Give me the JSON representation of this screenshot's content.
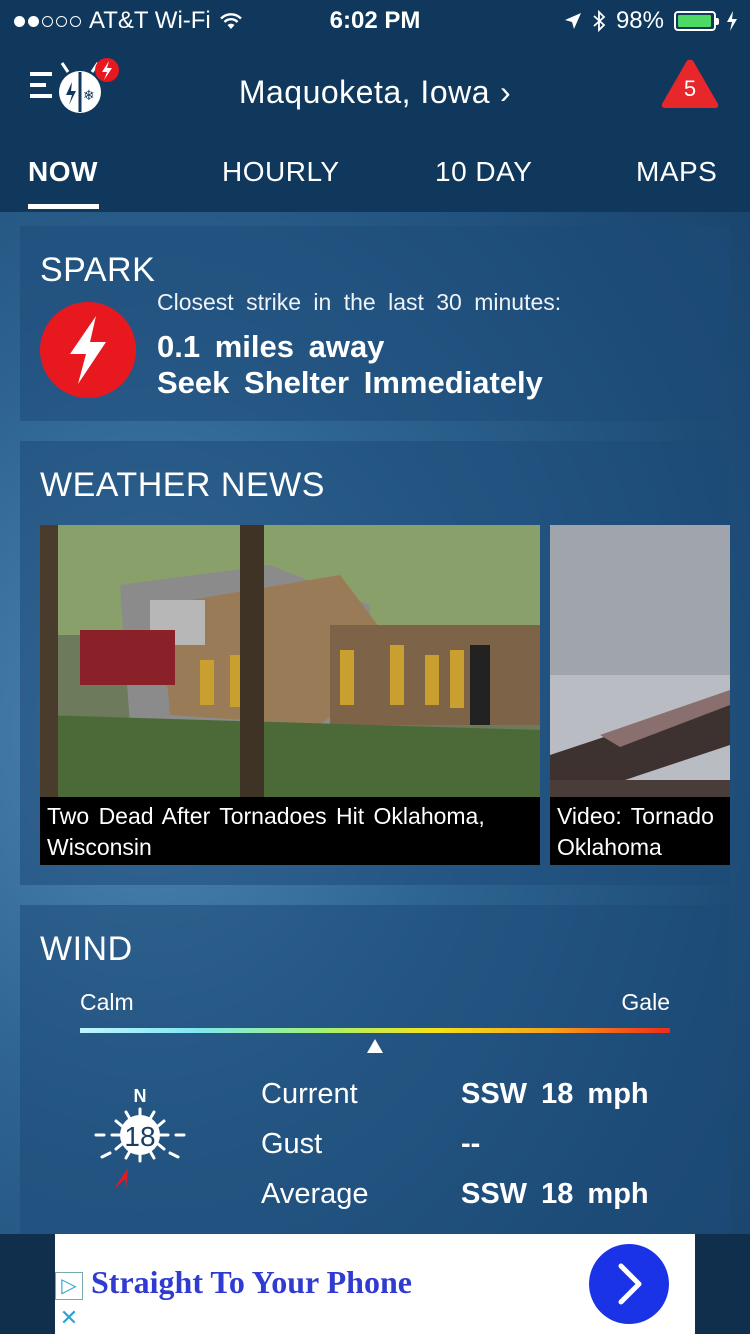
{
  "status_bar": {
    "carrier": "AT&T Wi-Fi",
    "time": "6:02 PM",
    "battery": "98%",
    "signal_dots_filled": 2,
    "signal_dots_total": 5,
    "icons": [
      "wifi-icon",
      "location-arrow-icon",
      "bluetooth-icon",
      "battery-icon",
      "charging-bolt-icon"
    ]
  },
  "header": {
    "location": "Maquoketa, Iowa",
    "location_chevron": "›",
    "alert_count": "5",
    "logo_icon": "weatherbug-logo-icon"
  },
  "tabs": [
    {
      "label": "NOW",
      "active": true
    },
    {
      "label": "HOURLY",
      "active": false
    },
    {
      "label": "10 DAY",
      "active": false
    },
    {
      "label": "MAPS",
      "active": false
    }
  ],
  "spark": {
    "title": "SPARK",
    "subtitle": "Closest strike in the last 30 minutes:",
    "distance": "0.1 miles away",
    "advice": "Seek Shelter Immediately",
    "icon": "lightning-bolt-icon",
    "accent": "#e8181f"
  },
  "news": {
    "title": "WEATHER NEWS",
    "items": [
      {
        "caption": "Two Dead After Tornadoes Hit Oklahoma, Wisconsin"
      },
      {
        "caption": "Video: Tornado Oklahoma"
      }
    ]
  },
  "wind": {
    "title": "WIND",
    "scale_min_label": "Calm",
    "scale_max_label": "Gale",
    "scale_position": 0.5,
    "compass_label": "N",
    "speed": "18",
    "rows": [
      {
        "label": "Current",
        "value": "SSW 18 mph"
      },
      {
        "label": "Gust",
        "value": "--"
      },
      {
        "label": "Average",
        "value": "SSW 18 mph"
      }
    ]
  },
  "ad": {
    "text": "Straight To Your Phone",
    "ad_choices_icon": "ad-choices-icon",
    "close_icon": "close-icon",
    "cta_icon": "chevron-right-icon"
  }
}
